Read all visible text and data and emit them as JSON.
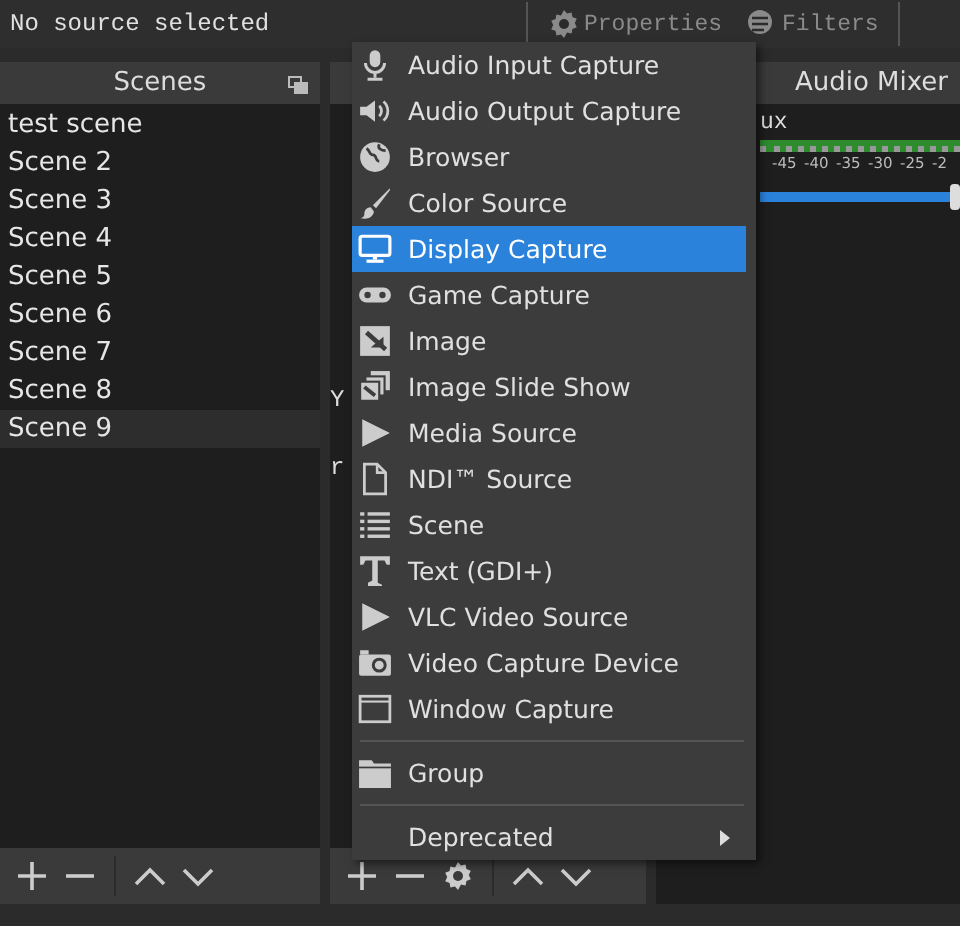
{
  "top_bar": {
    "status": "No source selected",
    "buttons": [
      {
        "label": "Properties",
        "disabled": true
      },
      {
        "label": "Filters",
        "disabled": true
      }
    ]
  },
  "scenes": {
    "title": "Scenes",
    "items": [
      {
        "label": "test scene",
        "selected": false
      },
      {
        "label": "Scene 2",
        "selected": false
      },
      {
        "label": "Scene 3",
        "selected": false
      },
      {
        "label": "Scene 4",
        "selected": false
      },
      {
        "label": "Scene 5",
        "selected": false
      },
      {
        "label": "Scene 6",
        "selected": false
      },
      {
        "label": "Scene 7",
        "selected": false
      },
      {
        "label": "Scene 8",
        "selected": false
      },
      {
        "label": "Scene 9",
        "selected": true
      }
    ]
  },
  "sources": {
    "fragments": [
      "Y",
      "r"
    ]
  },
  "audio_mixer": {
    "title": "Audio Mixer",
    "channel": "ux",
    "ticks": [
      "-45",
      "-40",
      "-35",
      "-30",
      "-25",
      "-2"
    ],
    "volume": {
      "level": 1
    }
  },
  "add_source_menu": {
    "sections": [
      [
        {
          "label": "Audio Input Capture",
          "selected": false,
          "submenu": false
        },
        {
          "label": "Audio Output Capture",
          "selected": false,
          "submenu": false
        },
        {
          "label": "Browser",
          "selected": false,
          "submenu": false
        },
        {
          "label": "Color Source",
          "selected": false,
          "submenu": false
        },
        {
          "label": "Display Capture",
          "selected": true,
          "submenu": false
        },
        {
          "label": "Game Capture",
          "selected": false,
          "submenu": false
        },
        {
          "label": "Image",
          "selected": false,
          "submenu": false
        },
        {
          "label": "Image Slide Show",
          "selected": false,
          "submenu": false
        },
        {
          "label": "Media Source",
          "selected": false,
          "submenu": false
        },
        {
          "label": "NDI™ Source",
          "selected": false,
          "submenu": false
        },
        {
          "label": "Scene",
          "selected": false,
          "submenu": false
        },
        {
          "label": "Text (GDI+)",
          "selected": false,
          "submenu": false
        },
        {
          "label": "VLC Video Source",
          "selected": false,
          "submenu": false
        },
        {
          "label": "Video Capture Device",
          "selected": false,
          "submenu": false
        },
        {
          "label": "Window Capture",
          "selected": false,
          "submenu": false
        }
      ],
      [
        {
          "label": "Group",
          "selected": false,
          "submenu": false
        }
      ],
      [
        {
          "label": "Deprecated",
          "selected": false,
          "submenu": true
        }
      ]
    ]
  }
}
